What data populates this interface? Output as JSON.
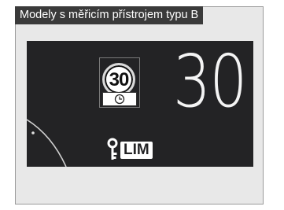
{
  "header": {
    "title": "Modely s měřicím přístrojem typu B"
  },
  "display": {
    "current_speed": "30",
    "speed_limit_sign": {
      "value": "30",
      "icon": "clock-icon"
    },
    "limiter": {
      "label": "LIM",
      "icon": "limiter-key-icon"
    }
  },
  "colors": {
    "header_bg": "#3a3a3a",
    "panel_bg": "#e8e8e8",
    "display_bg": "#232325",
    "display_text": "#f4f4f4"
  }
}
